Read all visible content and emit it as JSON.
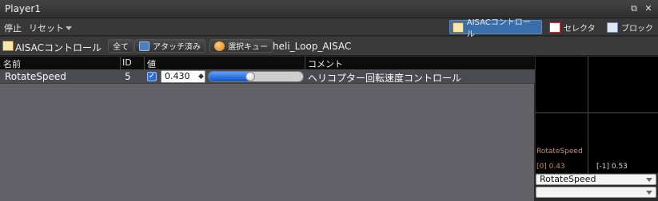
{
  "window": {
    "title": "Player1"
  },
  "menu": {
    "stop": "停止",
    "reset": "リセット"
  },
  "modes": [
    {
      "label": "AISACコントロール",
      "active": true
    },
    {
      "label": "セレクタ",
      "active": false
    },
    {
      "label": "ブロック",
      "active": false
    }
  ],
  "toolbar": {
    "aisac_label": "AISACコントロール",
    "all_button": "全て",
    "attached_button": "アタッチ済み",
    "selected_cue_button": "選択キュー",
    "cue_name": "heli_Loop_AISAC"
  },
  "grid": {
    "columns": [
      "名前",
      "ID",
      "値",
      "コメント"
    ],
    "rows": [
      {
        "name": "RotateSpeed",
        "id": "5",
        "checked": true,
        "value": "0.430",
        "slider_fraction": 0.43,
        "comment": "ヘリコプター回転速度コントロール"
      }
    ]
  },
  "graph": {
    "name": "RotateSpeed",
    "left_readout": "[0] 0.43",
    "right_readout": "[-1] 0.53",
    "select_primary": "RotateSpeed",
    "select_secondary": ""
  },
  "colors": {
    "accent": "#3a6ea8",
    "graph_label": "#c8906a"
  }
}
